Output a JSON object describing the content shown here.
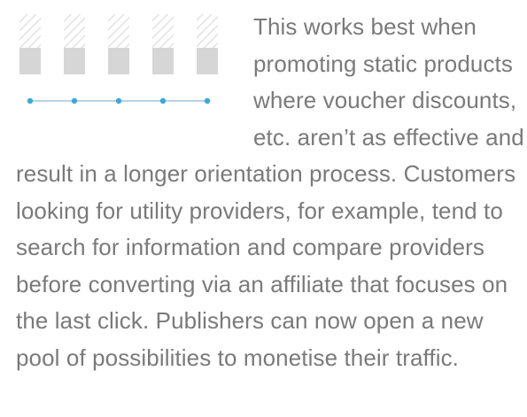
{
  "article": {
    "paragraph": "This works best when promoting static products where voucher discounts, etc. aren’t as effective and result in a longer orientation process. Customers looking for utility providers, for example, tend to search for information and compare providers before converting via an affiliate that focuses on the last click. Publishers can now open a new pool of possibilities to monetise their traffic."
  },
  "illustration": {
    "icon": "bar-timeline-icon",
    "bar_count": 5,
    "colors": {
      "bar_fill": "#d6d6d6",
      "hatch_stroke": "#e2e2e2",
      "timeline_line": "#9fc7dd",
      "timeline_dot": "#39a9dc"
    }
  },
  "colors": {
    "text": "#7a7a7a",
    "background": "#ffffff"
  }
}
